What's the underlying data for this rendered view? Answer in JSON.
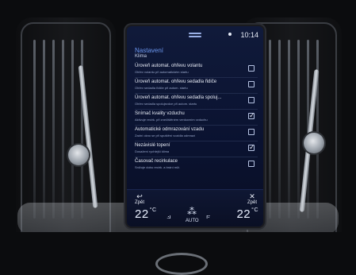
{
  "screen": {
    "time": "10:14",
    "title": "Nastavení",
    "subtitle": "Klima",
    "rows": [
      {
        "main": "Úroveň automat. ohřevu volantu",
        "sub": "Ohřev volantu při automatickém startu",
        "checked": false
      },
      {
        "main": "Úroveň automat. ohřevu sedadla řidiče",
        "sub": "Ohřev sedadla řidiče při autom. startu",
        "checked": false
      },
      {
        "main": "Úroveň automat. ohřevu sedadla spoluj...",
        "sub": "Ohřev sedadla spolujezdce při autom. startu",
        "checked": false
      },
      {
        "main": "Snímač kvality vzduchu",
        "sub": "Aktivuje recirk. při znečištěném venkovním vzduchu",
        "checked": true
      },
      {
        "main": "Automatické odmrazování vzadu",
        "sub": "Zadní okno se při spuštění vozidla odmrazí",
        "checked": false
      },
      {
        "main": "Nezávislé topení",
        "sub": "Dosažení rychlejší klima",
        "checked": true
      },
      {
        "main": "Časovač recirkulace",
        "sub": "Snižuje dobu recirk. a brání mlž.",
        "checked": false
      }
    ],
    "bottom": {
      "back_label": "Zpět",
      "close_label": "Zpět",
      "left_temp": "22",
      "right_temp": "22",
      "temp_unit": "°C",
      "auto_label": "AUTO"
    }
  }
}
